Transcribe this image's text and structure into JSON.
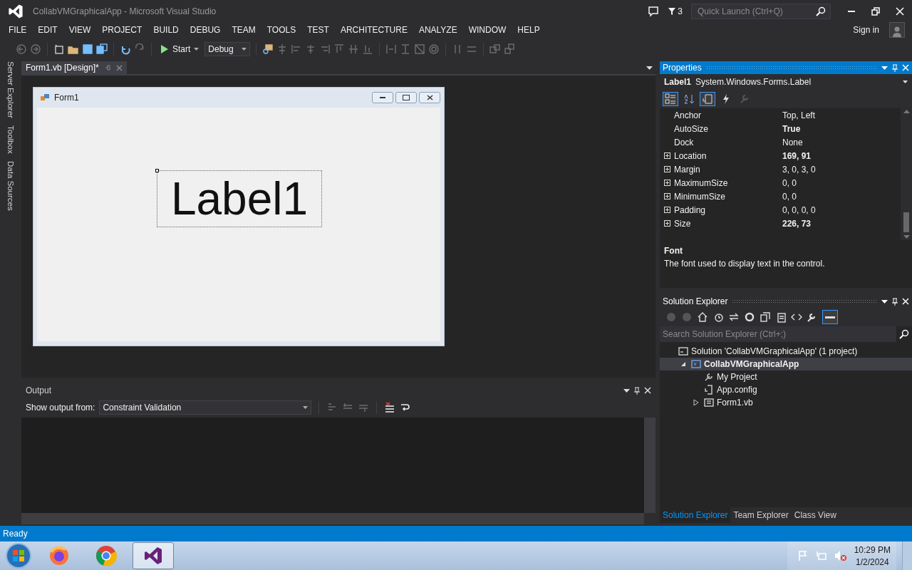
{
  "window": {
    "title": "CollabVMGraphicalApp - Microsoft Visual Studio",
    "notifications": "3",
    "quick_launch": {
      "placeholder": "Quick Launch (Ctrl+Q)"
    }
  },
  "menu": [
    "FILE",
    "EDIT",
    "VIEW",
    "PROJECT",
    "BUILD",
    "DEBUG",
    "TEAM",
    "TOOLS",
    "TEST",
    "ARCHITECTURE",
    "ANALYZE",
    "WINDOW",
    "HELP"
  ],
  "sign_in": "Sign in",
  "toolbar": {
    "start": "Start",
    "configuration": "Debug"
  },
  "side_tabs": [
    "Server Explorer",
    "Toolbox",
    "Data Sources"
  ],
  "document_tabs": [
    {
      "label": "Form1.vb [Design]*",
      "selected": true
    }
  ],
  "designer": {
    "form_title": "Form1",
    "label": "Label1"
  },
  "properties": {
    "title": "Properties",
    "object_name": "Label1",
    "object_type": "System.Windows.Forms.Label",
    "view_buttons": [
      {
        "kind": "categorized",
        "selected": true
      },
      {
        "kind": "alphabetical",
        "selected": false
      },
      {
        "kind": "properties",
        "selected": true
      },
      {
        "kind": "events",
        "selected": false
      },
      {
        "kind": "pages",
        "selected": false
      }
    ],
    "rows": [
      {
        "name": "Anchor",
        "value": "Top, Left",
        "expandable": false,
        "modified": false
      },
      {
        "name": "AutoSize",
        "value": "True",
        "expandable": false,
        "modified": true
      },
      {
        "name": "Dock",
        "value": "None",
        "expandable": false,
        "modified": false
      },
      {
        "name": "Location",
        "value": "169, 91",
        "expandable": true,
        "modified": true
      },
      {
        "name": "Margin",
        "value": "3, 0, 3, 0",
        "expandable": true,
        "modified": false
      },
      {
        "name": "MaximumSize",
        "value": "0, 0",
        "expandable": true,
        "modified": false
      },
      {
        "name": "MinimumSize",
        "value": "0, 0",
        "expandable": true,
        "modified": false
      },
      {
        "name": "Padding",
        "value": "0, 0, 0, 0",
        "expandable": true,
        "modified": false
      },
      {
        "name": "Size",
        "value": "226, 73",
        "expandable": true,
        "modified": true
      }
    ],
    "description": {
      "title": "Font",
      "text": "The font used to display text in the control."
    }
  },
  "output": {
    "title": "Output",
    "source_label": "Show output from:",
    "source": "Constraint Validation"
  },
  "solution_explorer": {
    "title": "Solution Explorer",
    "search": {
      "placeholder": "Search Solution Explorer (Ctrl+;)"
    },
    "tree": [
      {
        "kind": "solution",
        "label": "Solution 'CollabVMGraphicalApp' (1 project)",
        "bold": false,
        "selected": false,
        "children": [
          {
            "kind": "project",
            "label": "CollabVMGraphicalApp",
            "bold": true,
            "selected": true,
            "expanded": true,
            "children": [
              {
                "kind": "settings",
                "label": "My Project",
                "bold": false,
                "selected": false
              },
              {
                "kind": "config",
                "label": "App.config",
                "bold": false,
                "selected": false
              },
              {
                "kind": "form",
                "label": "Form1.vb",
                "bold": false,
                "selected": false,
                "expanded": false
              }
            ]
          }
        ]
      }
    ],
    "tabs": [
      {
        "label": "Solution Explorer",
        "selected": true
      },
      {
        "label": "Team Explorer",
        "selected": false
      },
      {
        "label": "Class View",
        "selected": false
      }
    ]
  },
  "status_bar": {
    "text": "Ready"
  },
  "taskbar": {
    "apps": [
      {
        "kind": "firefox",
        "selected": false
      },
      {
        "kind": "chrome",
        "selected": false
      },
      {
        "kind": "visual-studio",
        "selected": true
      }
    ],
    "time": "10:29 PM",
    "date": "1/2/2024"
  }
}
